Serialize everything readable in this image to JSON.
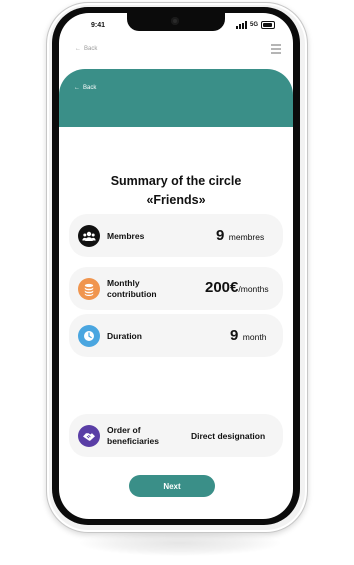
{
  "status_bar": {
    "time": "9:41",
    "network": "5G"
  },
  "nav": {
    "top_back_label": "Back",
    "banner_back_label": "Back"
  },
  "title": {
    "line1": "Summary of the circle",
    "line2": "«Friends»"
  },
  "cards": [
    {
      "label": "Membres",
      "value": "9",
      "unit": "membres",
      "icon": "members-icon",
      "icon_color": "#111111"
    },
    {
      "label": "Monthly contribution",
      "value": "200€",
      "unit": "/months",
      "icon": "coins-icon",
      "icon_color": "#f0954e"
    },
    {
      "label": "Duration",
      "value": "9",
      "unit": "month",
      "icon": "clock-icon",
      "icon_color": "#4aa6e0"
    },
    {
      "label": "Order of beneficiaries",
      "value": "Direct designation",
      "icon": "handshake-icon",
      "icon_color": "#5a3ea6"
    }
  ],
  "next_button": {
    "label": "Next"
  },
  "colors": {
    "accent": "#3a8f88",
    "card_bg": "#f5f5f5"
  }
}
